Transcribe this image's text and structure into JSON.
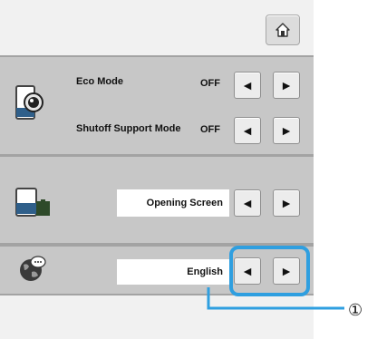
{
  "header": {
    "home_icon": "home-icon"
  },
  "settings": {
    "eco_mode": {
      "label": "Eco Mode",
      "value": "OFF",
      "icon": "eco-mode-icon"
    },
    "shutoff_support_mode": {
      "label": "Shutoff Support Mode",
      "value": "OFF"
    },
    "screen_saver": {
      "value": "Opening Screen",
      "icon": "screen-saver-icon"
    },
    "language": {
      "value": "English",
      "icon": "globe-icon"
    }
  },
  "buttons": {
    "left": "◄",
    "right": "►"
  },
  "annotation": {
    "callout_number": "①"
  },
  "colors": {
    "highlight": "#2f9fe0",
    "panel": "#c7c7c7",
    "background": "#f1f1f1"
  }
}
